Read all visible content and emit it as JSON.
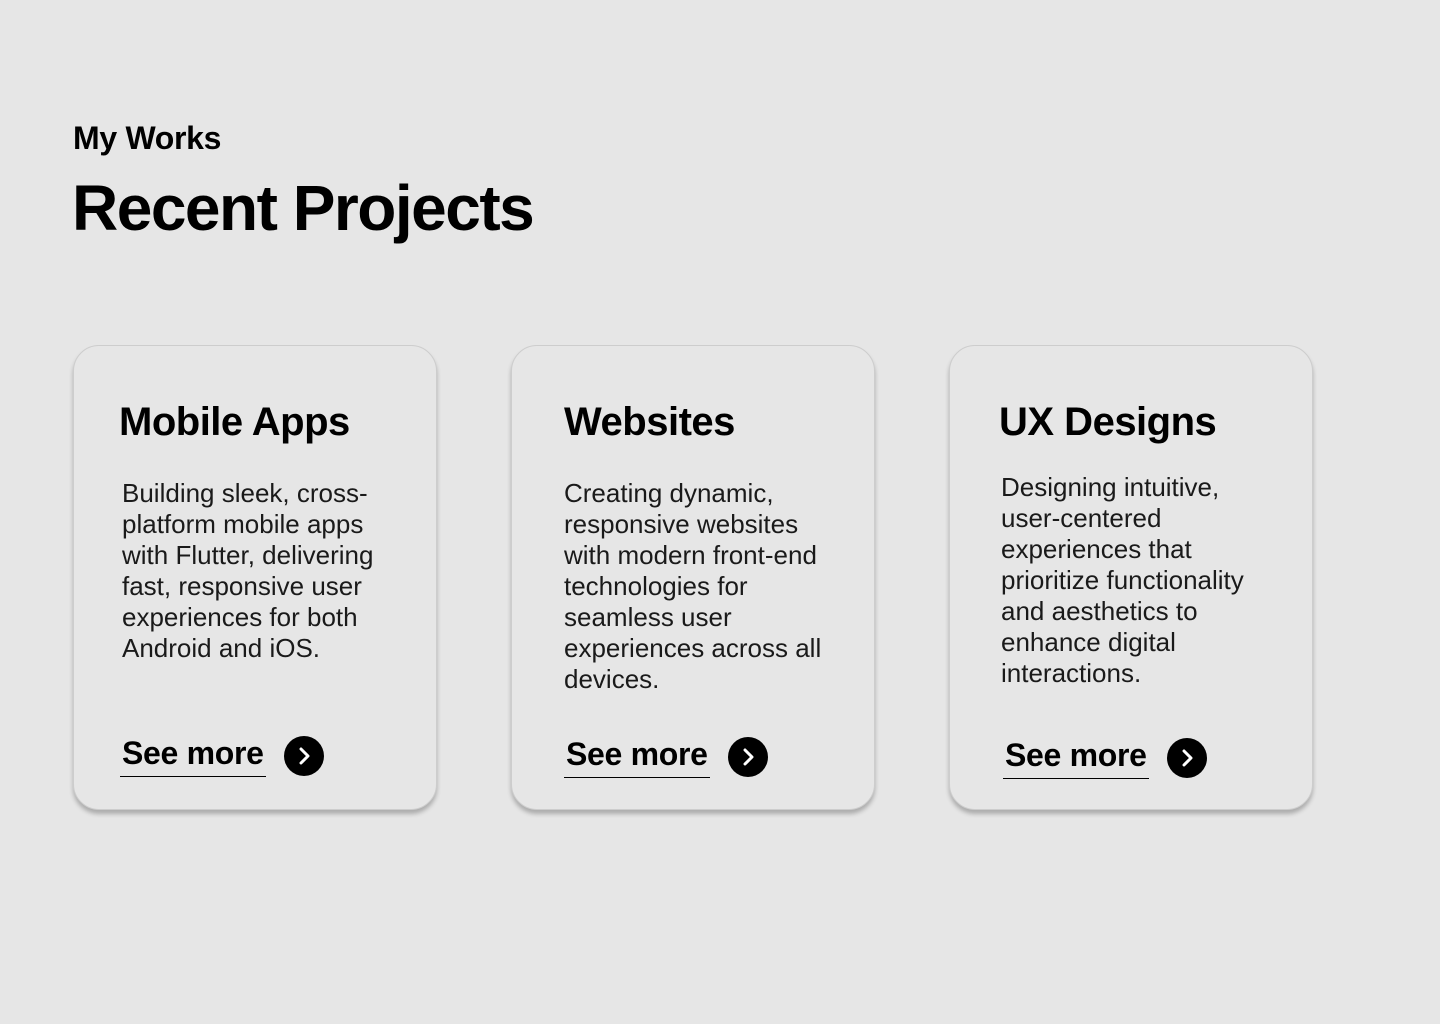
{
  "header": {
    "eyebrow": "My Works",
    "title": "Recent Projects"
  },
  "cards": [
    {
      "title": "Mobile Apps",
      "description": "Building sleek, cross-\nplatform mobile apps\nwith Flutter, delivering\nfast, responsive user\nexperiences for both\nAndroid and iOS.",
      "link_label": "See more",
      "icon": "chevron-right-icon"
    },
    {
      "title": "Websites",
      "description": "Creating dynamic,\nresponsive websites\nwith modern front-end\ntechnologies for\nseamless user\nexperiences across all\ndevices.",
      "link_label": "See more",
      "icon": "chevron-right-icon"
    },
    {
      "title": "UX Designs",
      "description": "Designing intuitive,\nuser-centered\nexperiences that\nprioritize functionality\nand aesthetics to\nenhance digital\ninteractions.",
      "link_label": "See more",
      "icon": "chevron-right-icon"
    }
  ],
  "colors": {
    "background": "#e6e6e6",
    "text": "#000000",
    "card_border": "#cdcdcd",
    "button": "#000000"
  }
}
